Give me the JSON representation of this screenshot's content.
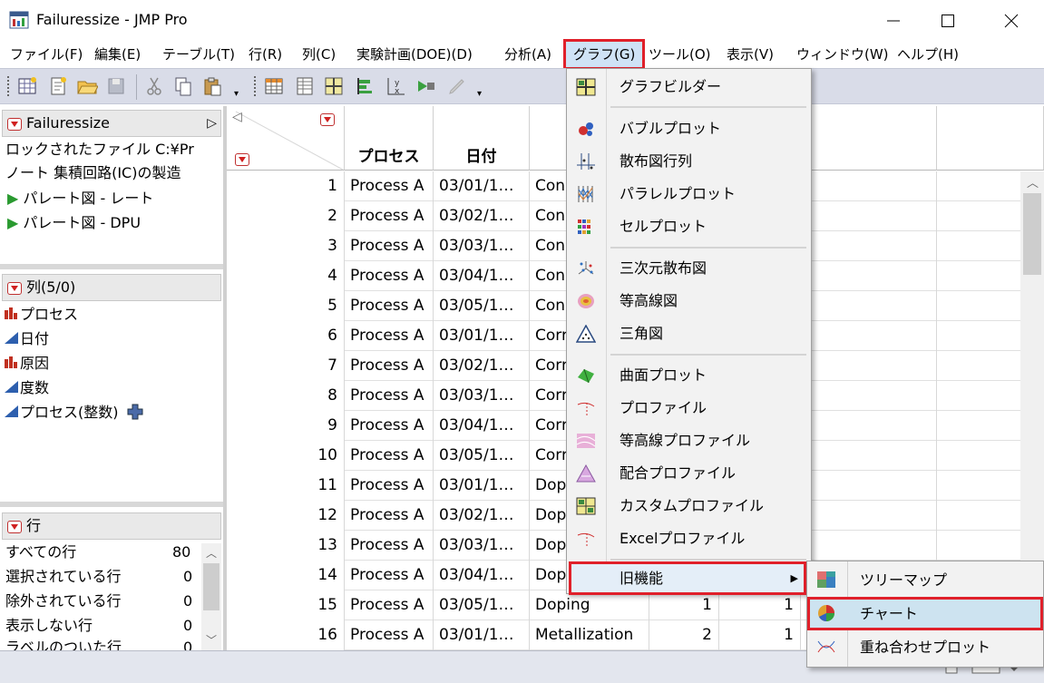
{
  "window": {
    "title": "Failuressize - JMP Pro"
  },
  "menubar": {
    "items": [
      "ファイル(F)",
      "編集(E)",
      "テーブル(T)",
      "行(R)",
      "列(C)",
      "実験計画(DOE)(D)",
      "分析(A)",
      "グラフ(G)",
      "ツール(O)",
      "表示(V)",
      "ウィンドウ(W)",
      "ヘルプ(H)"
    ],
    "active": "グラフ(G)"
  },
  "table_panel": {
    "title": "Failuressize",
    "locked_file": "ロックされたファイル C:¥Pr",
    "note": "ノート 集積回路(IC)の製造",
    "scripts": [
      "パレート図 - レート",
      "パレート図 - DPU"
    ]
  },
  "columns_panel": {
    "title": "列(5/0)",
    "columns": [
      "プロセス",
      "日付",
      "原因",
      "度数",
      "プロセス(整数)"
    ]
  },
  "rows_panel": {
    "title": "行",
    "stats": [
      {
        "label": "すべての行",
        "value": "80"
      },
      {
        "label": "選択されている行",
        "value": "0"
      },
      {
        "label": "除外されている行",
        "value": "0"
      },
      {
        "label": "表示しない行",
        "value": "0"
      },
      {
        "label": "ラベルのついた行",
        "value": "0"
      }
    ]
  },
  "grid": {
    "headers": [
      "プロセス",
      "日付"
    ],
    "rows": [
      {
        "n": "1",
        "process": "Process A",
        "date": "03/01/1…",
        "cause": "Con",
        "a": "",
        "b": ""
      },
      {
        "n": "2",
        "process": "Process A",
        "date": "03/02/1…",
        "cause": "Con",
        "a": "",
        "b": ""
      },
      {
        "n": "3",
        "process": "Process A",
        "date": "03/03/1…",
        "cause": "Con",
        "a": "",
        "b": ""
      },
      {
        "n": "4",
        "process": "Process A",
        "date": "03/04/1…",
        "cause": "Con",
        "a": "",
        "b": ""
      },
      {
        "n": "5",
        "process": "Process A",
        "date": "03/05/1…",
        "cause": "Con",
        "a": "",
        "b": ""
      },
      {
        "n": "6",
        "process": "Process A",
        "date": "03/01/1…",
        "cause": "Corr",
        "a": "",
        "b": ""
      },
      {
        "n": "7",
        "process": "Process A",
        "date": "03/02/1…",
        "cause": "Corr",
        "a": "",
        "b": ""
      },
      {
        "n": "8",
        "process": "Process A",
        "date": "03/03/1…",
        "cause": "Corr",
        "a": "",
        "b": ""
      },
      {
        "n": "9",
        "process": "Process A",
        "date": "03/04/1…",
        "cause": "Corr",
        "a": "",
        "b": ""
      },
      {
        "n": "10",
        "process": "Process A",
        "date": "03/05/1…",
        "cause": "Corr",
        "a": "",
        "b": ""
      },
      {
        "n": "11",
        "process": "Process A",
        "date": "03/01/1…",
        "cause": "Dop",
        "a": "",
        "b": ""
      },
      {
        "n": "12",
        "process": "Process A",
        "date": "03/02/1…",
        "cause": "Dop",
        "a": "",
        "b": ""
      },
      {
        "n": "13",
        "process": "Process A",
        "date": "03/03/1…",
        "cause": "Dop",
        "a": "",
        "b": ""
      },
      {
        "n": "14",
        "process": "Process A",
        "date": "03/04/1…",
        "cause": "Dop",
        "a": "",
        "b": ""
      },
      {
        "n": "15",
        "process": "Process A",
        "date": "03/05/1…",
        "cause": "Doping",
        "a": "1",
        "b": "1"
      },
      {
        "n": "16",
        "process": "Process A",
        "date": "03/01/1…",
        "cause": "Metallization",
        "a": "2",
        "b": "1"
      }
    ]
  },
  "graph_menu": {
    "items": [
      "グラフビルダー",
      "バブルプロット",
      "散布図行列",
      "パラレルプロット",
      "セルプロット",
      "三次元散布図",
      "等高線図",
      "三角図",
      "曲面プロット",
      "プロファイル",
      "等高線プロファイル",
      "配合プロファイル",
      "カスタムプロファイル",
      "Excelプロファイル",
      "旧機能"
    ],
    "submenu": [
      "ツリーマップ",
      "チャート",
      "重ね合わせプロット"
    ]
  }
}
